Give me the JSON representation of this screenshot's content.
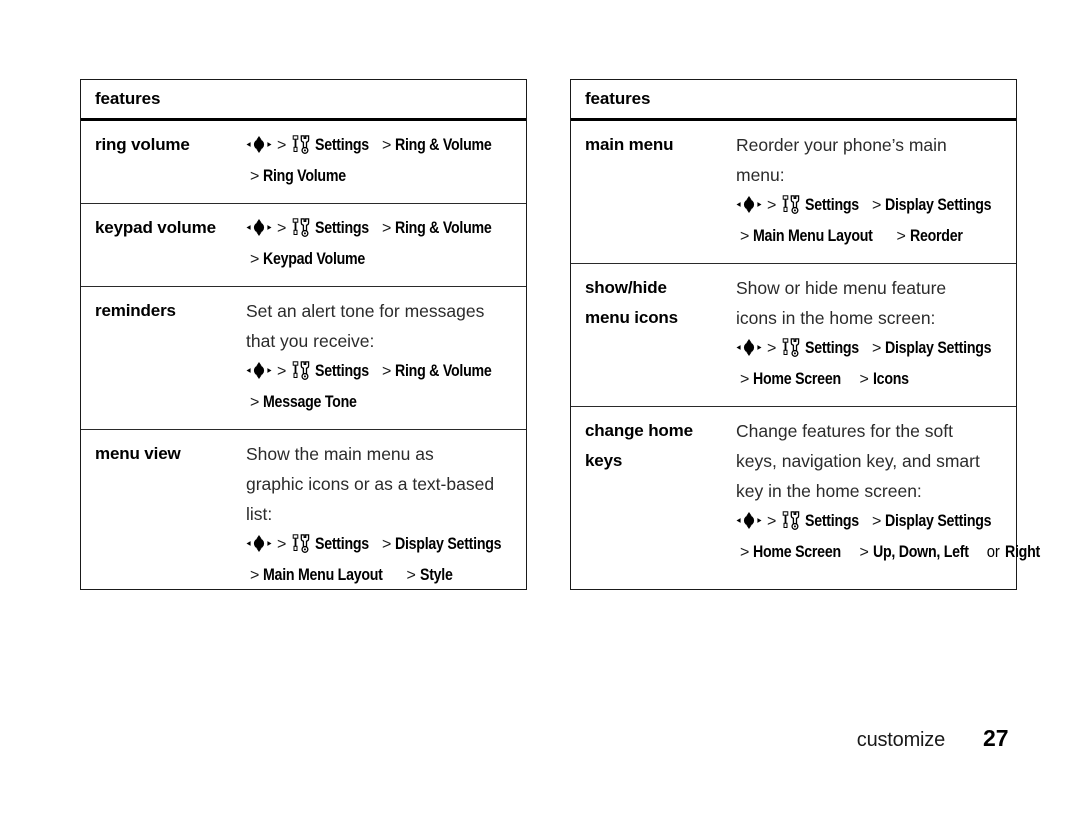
{
  "page": {
    "chapter_label": "customize",
    "page_number": "27"
  },
  "icons": {
    "nav": "navigation-key-icon",
    "tools": "settings-tools-icon"
  },
  "tables": [
    {
      "id": "left",
      "header": "features",
      "rows": [
        {
          "term": [
            "ring volume"
          ],
          "desc_lines": [],
          "paths": [
            {
              "icons": [
                "nav",
                "tools"
              ],
              "segments": [
                "Settings",
                "Ring & Volume"
              ]
            },
            {
              "icons": [],
              "segments": [
                "Ring Volume"
              ]
            }
          ]
        },
        {
          "term": [
            "keypad volume"
          ],
          "desc_lines": [],
          "paths": [
            {
              "icons": [
                "nav",
                "tools"
              ],
              "segments": [
                "Settings",
                "Ring & Volume"
              ]
            },
            {
              "icons": [],
              "segments": [
                "Keypad Volume"
              ]
            }
          ]
        },
        {
          "term": [
            "reminders"
          ],
          "desc_lines": [
            "Set an alert tone for messages",
            "that you receive:"
          ],
          "paths": [
            {
              "icons": [
                "nav",
                "tools"
              ],
              "segments": [
                "Settings",
                "Ring & Volume"
              ]
            },
            {
              "icons": [],
              "segments": [
                "Message Tone"
              ]
            }
          ]
        },
        {
          "term": [
            "menu view"
          ],
          "desc_lines": [
            "Show the main menu as",
            "graphic icons or as a text-based",
            "list:"
          ],
          "paths": [
            {
              "icons": [
                "nav",
                "tools"
              ],
              "segments": [
                "Settings",
                "Display Settings"
              ]
            },
            {
              "icons": [],
              "segments": [
                "Main Menu Layout",
                "Style"
              ]
            }
          ]
        }
      ]
    },
    {
      "id": "right",
      "header": "features",
      "rows": [
        {
          "term": [
            "main menu"
          ],
          "desc_lines": [
            "Reorder your phone’s main",
            "menu:"
          ],
          "paths": [
            {
              "icons": [
                "nav",
                "tools"
              ],
              "segments": [
                "Settings",
                "Display Settings"
              ]
            },
            {
              "icons": [],
              "segments": [
                "Main Menu Layout",
                "Reorder"
              ]
            }
          ]
        },
        {
          "term": [
            "show/hide",
            "menu icons"
          ],
          "desc_lines": [
            "Show or hide menu feature",
            "icons in the home screen:"
          ],
          "paths": [
            {
              "icons": [
                "nav",
                "tools"
              ],
              "segments": [
                "Settings",
                "Display Settings"
              ]
            },
            {
              "icons": [],
              "segments": [
                "Home Screen",
                "Icons"
              ]
            }
          ]
        },
        {
          "term": [
            "change home",
            "keys"
          ],
          "desc_lines": [
            "Change features for the soft",
            "keys, navigation key, and smart",
            "key in the home screen:"
          ],
          "paths": [
            {
              "icons": [
                "nav",
                "tools"
              ],
              "segments": [
                "Settings",
                "Display Settings"
              ]
            },
            {
              "icons": [],
              "segments": [
                "Home Screen",
                "Up, Down, Left"
              ],
              "tail_light": "or",
              "tail_bold": "Right"
            }
          ]
        }
      ]
    }
  ]
}
